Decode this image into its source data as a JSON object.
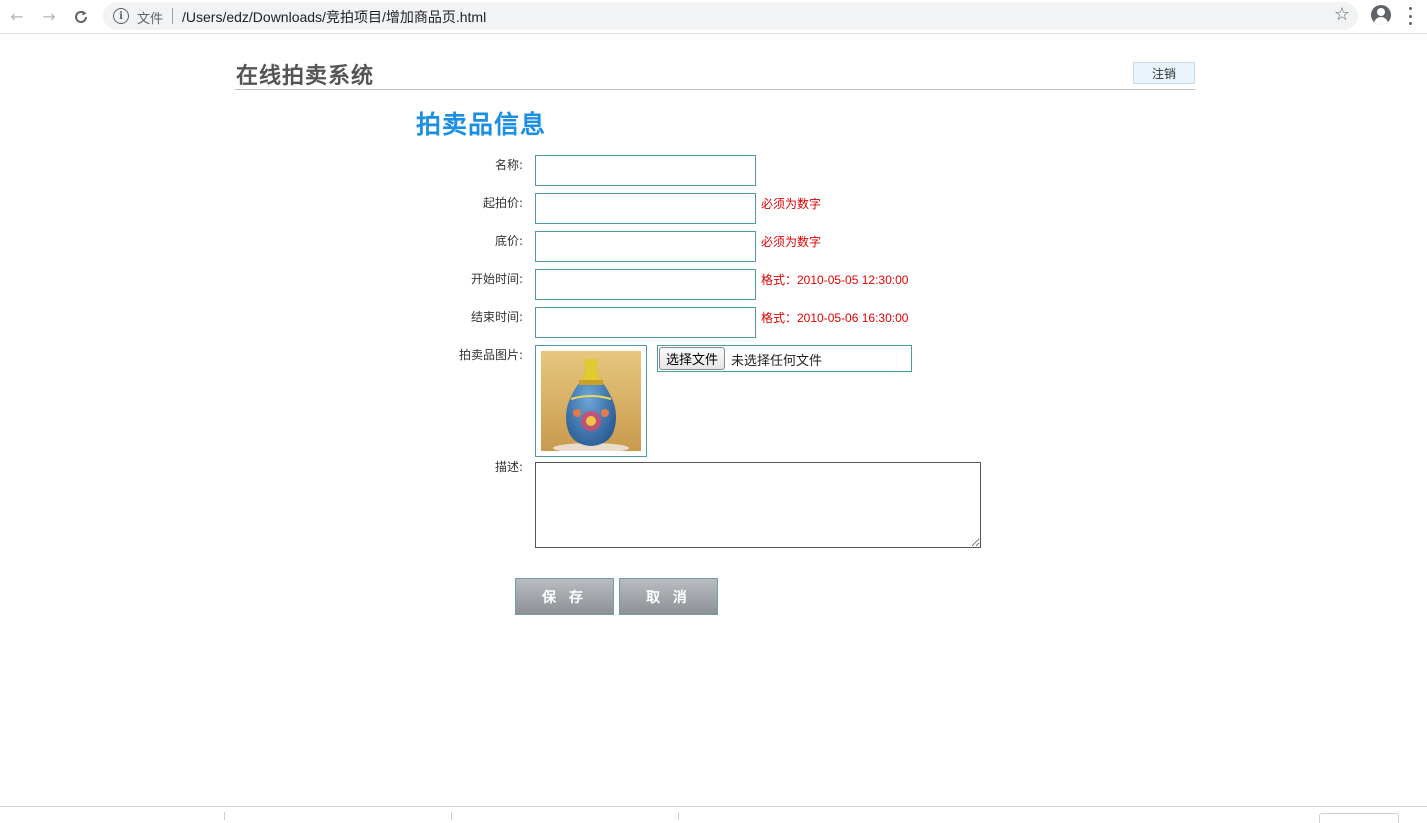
{
  "browser": {
    "scheme_label": "文件",
    "url": "/Users/edz/Downloads/竞拍项目/增加商品页.html"
  },
  "header": {
    "site_title": "在线拍卖系统",
    "logout_label": "注销"
  },
  "form": {
    "section_title": "拍卖品信息",
    "fields": {
      "name": {
        "label": "名称:",
        "value": ""
      },
      "start_price": {
        "label": "起拍价:",
        "value": "",
        "hint": "必须为数字"
      },
      "reserve_price": {
        "label": "底价:",
        "value": "",
        "hint": "必须为数字"
      },
      "start_time": {
        "label": "开始时间:",
        "value": "",
        "hint": "格式：2010-05-05 12:30:00"
      },
      "end_time": {
        "label": "结束时间:",
        "value": "",
        "hint": "格式：2010-05-06 16:30:00"
      },
      "image": {
        "label": "拍卖品图片:",
        "choose_label": "选择文件",
        "status": "未选择任何文件"
      },
      "description": {
        "label": "描述:",
        "value": ""
      }
    },
    "save_label": "保 存",
    "cancel_label": "取 消"
  }
}
